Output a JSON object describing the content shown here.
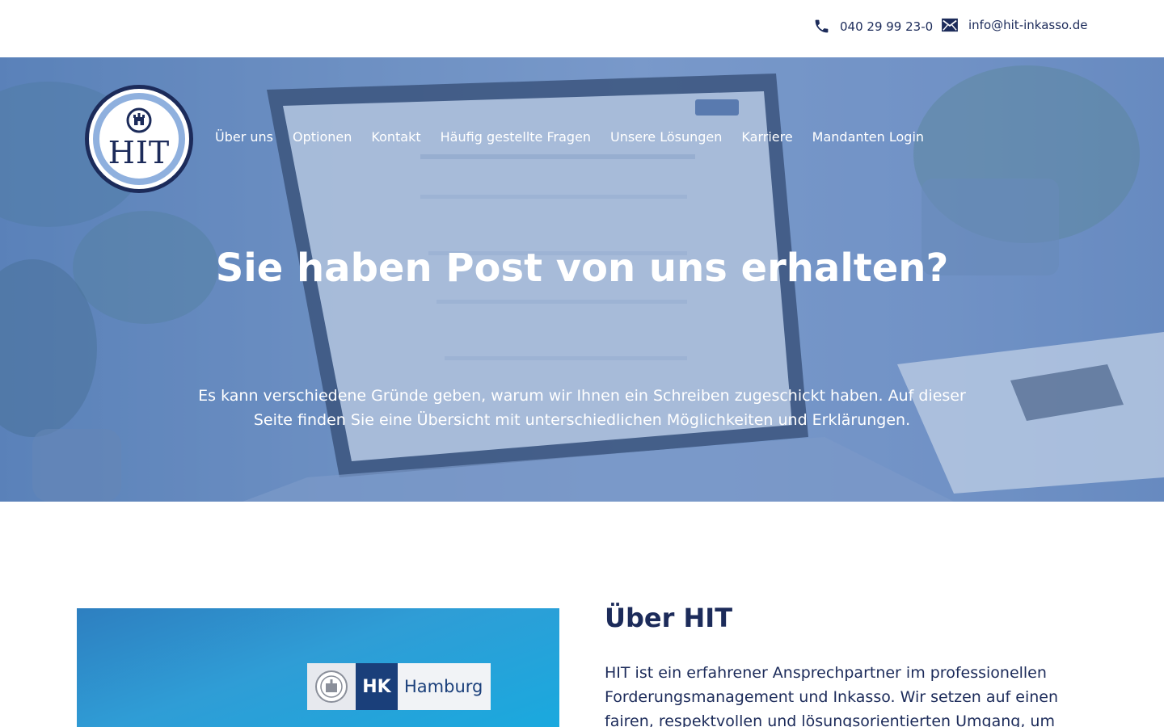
{
  "topbar": {
    "phone": {
      "icon": "phone-icon",
      "label": "040 29 99 23-0"
    },
    "email": {
      "icon": "mail-icon",
      "label": "info@hit-inkasso.de"
    }
  },
  "logo": {
    "text": "HIT"
  },
  "nav": {
    "items": [
      {
        "label": "Über uns"
      },
      {
        "label": "Optionen"
      },
      {
        "label": "Kontakt"
      },
      {
        "label": "Häufig gestellte Fragen"
      },
      {
        "label": "Unsere Lösungen"
      },
      {
        "label": "Karriere"
      },
      {
        "label": "Mandanten Login"
      }
    ]
  },
  "hero": {
    "title": "Sie haben Post von uns erhalten?",
    "subtitle": "Es kann verschiedene Gründe geben, warum wir Ihnen ein Schreiben zugeschickt haben. Auf dieser Seite finden Sie eine Übersicht mit unterschiedlichen Möglichkeiten und Erklärungen."
  },
  "about": {
    "image": {
      "badge_short": "HK",
      "badge_city": "Hamburg"
    },
    "title": "Über HIT",
    "text": "HIT ist ein erfahrener Ansprechpartner im professionellen Forderungsmanagement und Inkasso. Wir setzen auf einen fairen, respektvollen und lösungsorientierten Umgang, um"
  },
  "colors": {
    "brand_navy": "#1c2b5a",
    "brand_light_blue": "#8fb0de",
    "hero_overlay": "#6f90c2"
  }
}
